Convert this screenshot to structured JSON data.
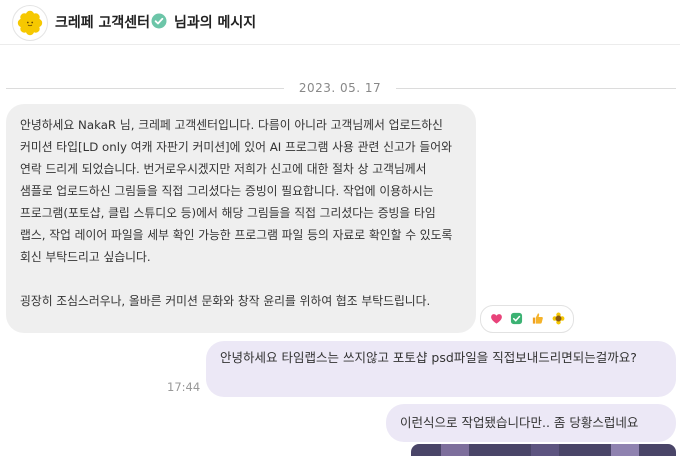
{
  "header": {
    "brand_name": "크레페 고객센터",
    "chat_title": "님과의 메시지",
    "brand_color": "#f6c800",
    "verified_color": "#6cc5a8"
  },
  "date_separator": "2023. 05. 17",
  "messages": [
    {
      "direction": "incoming",
      "paragraphs": [
        "안녕하세요 NakaR 님, 크레페 고객센터입니다. 다름이 아니라 고객님께서 업로드하신 커미션 타입[LD only 여캐 자판기 커미션]에 있어 AI 프로그램 사용 관련 신고가 들어와 연락 드리게 되었습니다. 번거로우시겠지만 저희가 신고에 대한 절차 상 고객님께서 샘플로 업로드하신 그림들을 직접 그리셨다는 증빙이 필요합니다. 작업에 이용하시는 프로그램(포토샵, 클립 스튜디오 등)에서 해당 그림들을 직접 그리셨다는 증빙을 타임 랩스, 작업 레이어 파일을 세부 확인 가능한 프로그램 파일 등의 자료로 확인할 수 있도록 회신 부탁드리고 싶습니다.",
        "굉장히 조심스러우나, 올바른 커미션 문화와 창작 윤리를 위하여 협조 부탁드립니다."
      ],
      "reactions": [
        "heart-icon",
        "check-icon",
        "thumbs-up-icon",
        "sunflower-icon"
      ]
    },
    {
      "direction": "outgoing",
      "text": "안녕하세요 타임랩스는 쓰지않고 포토샵 psd파일을 직접보내드리면되는걸까요?",
      "time": "17:44"
    },
    {
      "direction": "outgoing",
      "text": "이런식으로 작업됐습니다만.. 좀 당황스럽네요"
    }
  ]
}
